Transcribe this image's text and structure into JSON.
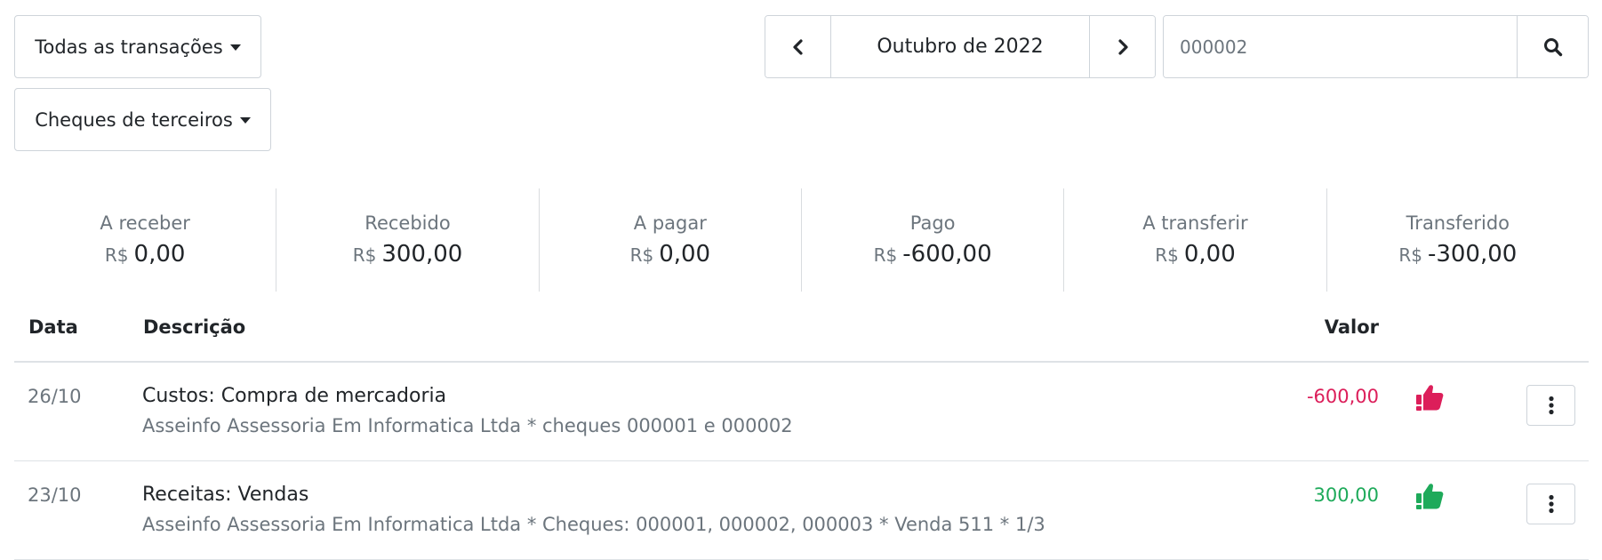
{
  "filters": {
    "transactions_label": "Todas as transações",
    "cheques_label": "Cheques de terceiros"
  },
  "period": {
    "label": "Outubro de 2022"
  },
  "search": {
    "value": "000002"
  },
  "summary": [
    {
      "label": "A receber",
      "currency": "R$",
      "value": "0,00"
    },
    {
      "label": "Recebido",
      "currency": "R$",
      "value": "300,00"
    },
    {
      "label": "A pagar",
      "currency": "R$",
      "value": "0,00"
    },
    {
      "label": "Pago",
      "currency": "R$",
      "value": "-600,00"
    },
    {
      "label": "A transferir",
      "currency": "R$",
      "value": "0,00"
    },
    {
      "label": "Transferido",
      "currency": "R$",
      "value": "-300,00"
    }
  ],
  "table": {
    "headers": {
      "date": "Data",
      "description": "Descrição",
      "amount": "Valor"
    },
    "rows": [
      {
        "date": "26/10",
        "description": "Custos: Compra de mercadoria",
        "details": "Asseinfo Assessoria Em Informatica Ltda * cheques 000001 e 000002",
        "amount": "-600,00",
        "amount_color": "#dc1e5a",
        "status_icon": "thumbs-up-alert-icon",
        "status_color": "#dc1e5a"
      },
      {
        "date": "23/10",
        "description": "Receitas: Vendas",
        "details": "Asseinfo Assessoria Em Informatica Ltda * Cheques: 000001, 000002, 000003 * Venda 511 * 1/3",
        "amount": "300,00",
        "amount_color": "#1eaa5a",
        "status_icon": "thumbs-up-alert-icon",
        "status_color": "#1eaa5a"
      }
    ]
  }
}
